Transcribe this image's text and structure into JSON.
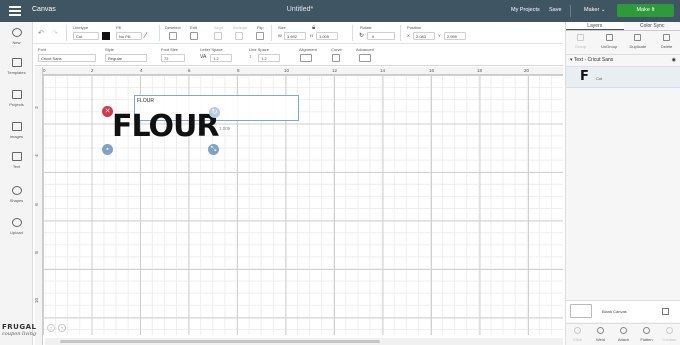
{
  "header": {
    "app_title": "Canvas",
    "doc_title": "Untitled*",
    "my_projects": "My Projects",
    "save": "Save",
    "machine": "Maker",
    "make_it": "Make It"
  },
  "toolbar": {
    "linetype_label": "Linetype",
    "linetype_value": "Cut",
    "fill_label": "Fill",
    "fill_value": "No Fill",
    "deselect": "Deselect",
    "edit": "Edit",
    "align": "Align",
    "arrange": "Arrange",
    "flip": "Flip",
    "size_label": "Size",
    "width_prefix": "W",
    "width_value": "3.692",
    "height_prefix": "H",
    "height_value": "1.005",
    "rotate_label": "Rotate",
    "rotate_value": "0",
    "position_label": "Position",
    "x_prefix": "X",
    "x_value": "2.083",
    "y_prefix": "Y",
    "y_value": "2.999"
  },
  "textbar": {
    "font_label": "Font",
    "font_value": "Cricut Sans",
    "style_label": "Style",
    "style_value": "Regular",
    "font_size_label": "Font Size",
    "font_size_value": "72",
    "letter_space_label": "Letter Space",
    "letter_space_value": "1.2",
    "line_space_label": "Line Space",
    "line_space_value": "1.2",
    "alignment_label": "Alignment",
    "curve_label": "Curve",
    "advanced_label": "Advanced"
  },
  "sidebar": {
    "items": [
      {
        "label": "New",
        "icon": "plus-icon"
      },
      {
        "label": "Templates",
        "icon": "shirt-icon"
      },
      {
        "label": "Projects",
        "icon": "projects-icon"
      },
      {
        "label": "Images",
        "icon": "image-icon"
      },
      {
        "label": "Text",
        "icon": "text-icon"
      },
      {
        "label": "Shapes",
        "icon": "shapes-icon"
      },
      {
        "label": "Upload",
        "icon": "upload-icon"
      }
    ]
  },
  "canvas": {
    "text_input": "FLOUR",
    "display_text": "FLOUR",
    "dimension_label": "1.005",
    "ruler_top": [
      "0",
      "2",
      "4",
      "6",
      "8",
      "10",
      "12",
      "14",
      "16",
      "18",
      "20"
    ],
    "ruler_left": [
      "2",
      "4",
      "6",
      "8",
      "10"
    ]
  },
  "layers_panel": {
    "tabs": [
      "Layers",
      "Color Sync"
    ],
    "actions": [
      "Group",
      "UnGroup",
      "Duplicate",
      "Delete"
    ],
    "group_title": "Text - Cricut Sans",
    "layer_glyph": "F",
    "layer_label": "Cut",
    "blank_canvas": "Blank Canvas",
    "bottom_actions": [
      "Slice",
      "Weld",
      "Attach",
      "Flatten",
      "Contour"
    ]
  },
  "logo": {
    "line1": "FRUGAL",
    "line2": "coupon living"
  },
  "colors": {
    "topbar": "#3f5561",
    "make_it": "#2e9b3a",
    "delete_handle": "#d9344c",
    "handle_blue": "#7fa2c8"
  }
}
